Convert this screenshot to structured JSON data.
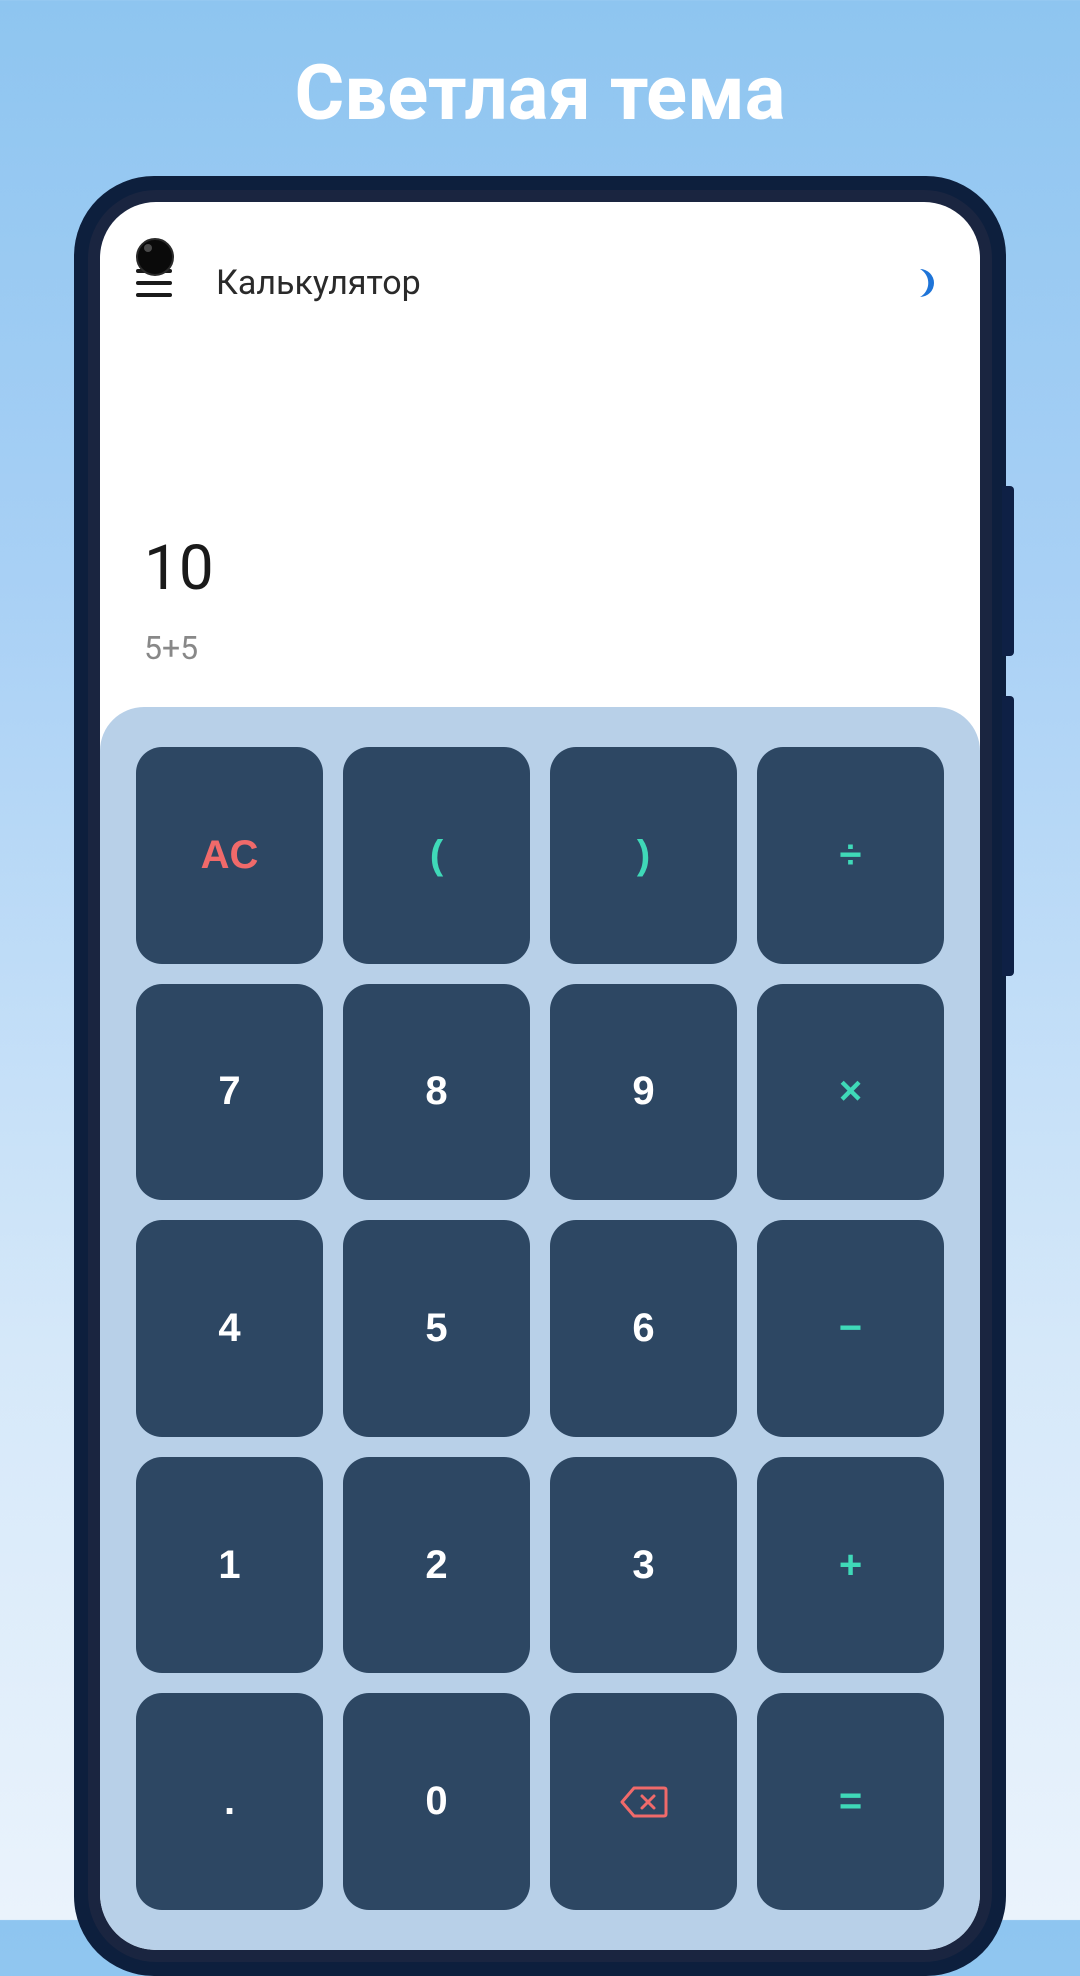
{
  "promo": {
    "title": "Светлая тема"
  },
  "header": {
    "title": "Калькулятор"
  },
  "display": {
    "result": "10",
    "expression": "5+5"
  },
  "keypad": {
    "r0": {
      "c0": "AC",
      "c1": "(",
      "c2": ")",
      "c3": "÷"
    },
    "r1": {
      "c0": "7",
      "c1": "8",
      "c2": "9",
      "c3": "×"
    },
    "r2": {
      "c0": "4",
      "c1": "5",
      "c2": "6",
      "c3": "−"
    },
    "r3": {
      "c0": "1",
      "c1": "2",
      "c2": "3",
      "c3": "+"
    },
    "r4": {
      "c0": ".",
      "c1": "0",
      "c3": "="
    }
  },
  "colors": {
    "button_bg": "#2d4763",
    "button_text": "#ffffff",
    "accent": "#3fd9b8",
    "danger": "#f06a6a",
    "panel_bg": "#b8d0e8",
    "theme_icon": "#1e74d8"
  }
}
